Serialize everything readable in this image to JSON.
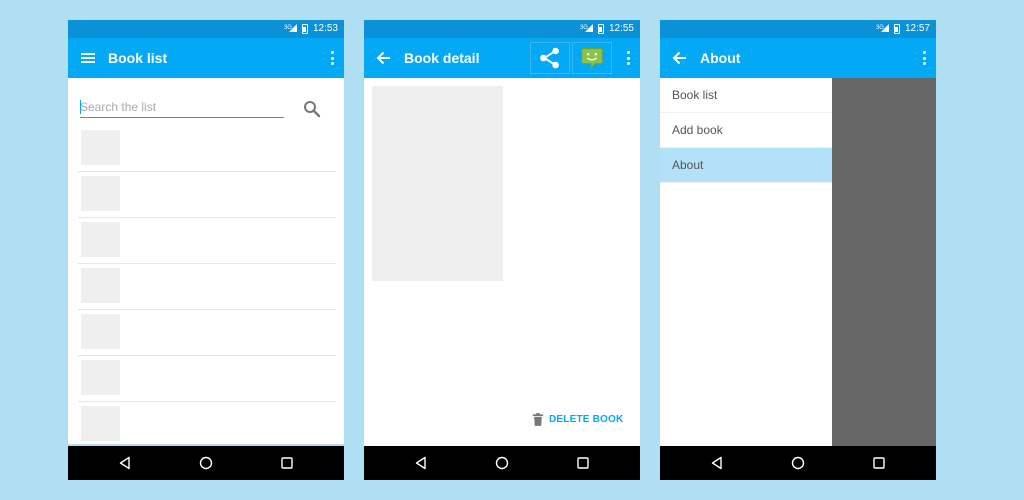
{
  "status": {
    "network": "3G",
    "time": [
      "12:53",
      "12:55",
      "12:57"
    ]
  },
  "screen1": {
    "title": "Book list",
    "search": {
      "placeholder": "Search the list",
      "value": ""
    },
    "list_count": 7
  },
  "screen2": {
    "title": "Book detail",
    "actions": [
      "share-icon",
      "smiley-icon"
    ],
    "delete_label": "DELETE BOOK"
  },
  "screen3": {
    "title": "About",
    "drawer": [
      {
        "label": "Book list"
      },
      {
        "label": "Add book"
      },
      {
        "label": "About"
      }
    ],
    "active_index": 2
  },
  "colors": {
    "background": "#b0dff3",
    "appbar": "#03a9f4",
    "statusbar": "#0a91d6",
    "accent": "#03a9f4",
    "scrim": "#666666",
    "drawer_active": "#b3e1f7"
  }
}
